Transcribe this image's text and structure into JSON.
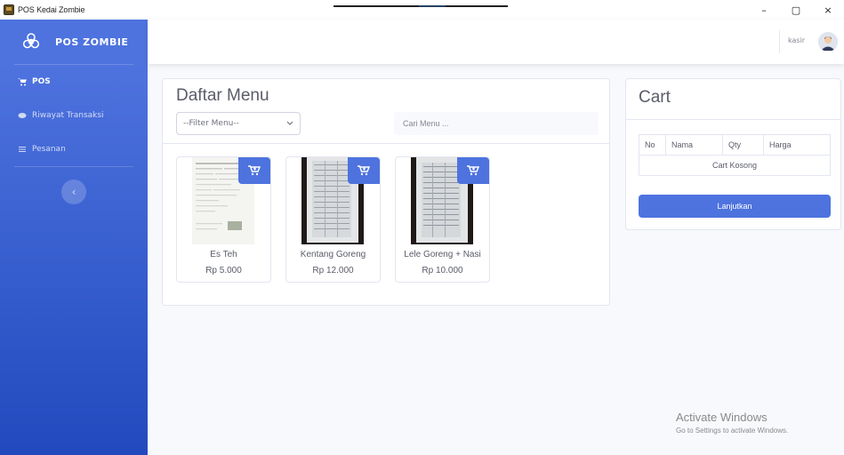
{
  "window": {
    "title": "POS Kedai Zombie",
    "controls": {
      "minimize": "–",
      "maximize": "▢",
      "close": "×"
    }
  },
  "sidebar": {
    "brand": "POS ZOMBIE",
    "items": [
      {
        "label": "POS",
        "icon": "cart-icon",
        "active": true
      },
      {
        "label": "Riwayat Transaksi",
        "icon": "coins-icon",
        "active": false
      },
      {
        "label": "Pesanan",
        "icon": "list-icon",
        "active": false
      }
    ],
    "toggle": "‹"
  },
  "topbar": {
    "user": "kasir"
  },
  "menu": {
    "title": "Daftar Menu",
    "filter_value": "--Filter Menu--",
    "search_placeholder": "Cari Menu ...",
    "products": [
      {
        "name": "Es Teh",
        "price": "Rp 5.000"
      },
      {
        "name": "Kentang Goreng",
        "price": "Rp 12.000"
      },
      {
        "name": "Lele Goreng + Nasi",
        "price": "Rp 10.000"
      }
    ]
  },
  "cart": {
    "title": "Cart",
    "columns": [
      "No",
      "Nama",
      "Qty",
      "Harga"
    ],
    "empty_text": "Cart Kosong",
    "button": "Lanjutkan"
  },
  "watermark": {
    "line1": "Activate Windows",
    "line2": "Go to Settings to activate Windows."
  },
  "colors": {
    "primary": "#4e73df",
    "sidebar_bottom": "#224abe"
  }
}
